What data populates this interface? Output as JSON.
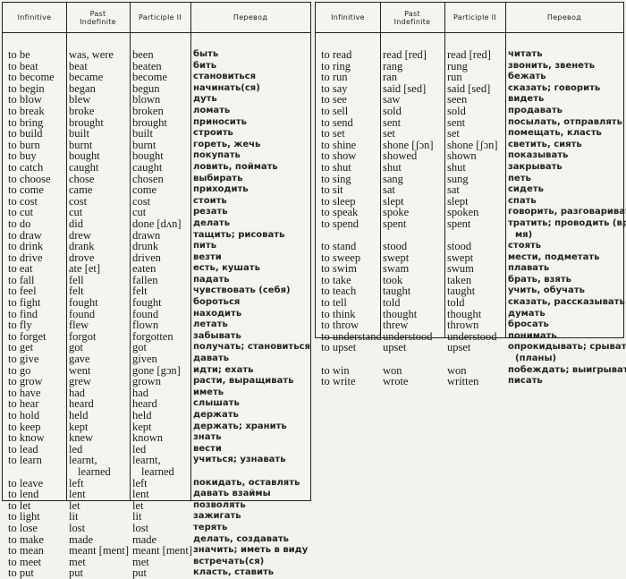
{
  "headers": {
    "infinitive": "Infinitive",
    "past_line1": "Past",
    "past_line2": "Indefinite",
    "participle": "Participle II",
    "translation": "Перевод"
  },
  "left_table": [
    {
      "inf": "to be",
      "past": "was, were",
      "part": "been",
      "ru": "быть"
    },
    {
      "inf": "to beat",
      "past": "beat",
      "part": "beaten",
      "ru": "бить"
    },
    {
      "inf": "to become",
      "past": "became",
      "part": "become",
      "ru": "становиться"
    },
    {
      "inf": "to begin",
      "past": "began",
      "part": "begun",
      "ru": "начинать(ся)"
    },
    {
      "inf": "to blow",
      "past": "blew",
      "part": "blown",
      "ru": "дуть"
    },
    {
      "inf": "to break",
      "past": "broke",
      "part": "broken",
      "ru": "ломать"
    },
    {
      "inf": "to bring",
      "past": "brought",
      "part": "brought",
      "ru": "приносить"
    },
    {
      "inf": "to build",
      "past": "built",
      "part": "built",
      "ru": "строить"
    },
    {
      "inf": "to burn",
      "past": "burnt",
      "part": "burnt",
      "ru": "гореть, жечь"
    },
    {
      "inf": "to buy",
      "past": "bought",
      "part": "bought",
      "ru": "покупать"
    },
    {
      "inf": "to catch",
      "past": "caught",
      "part": "caught",
      "ru": "ловить, поймать"
    },
    {
      "inf": "to choose",
      "past": "chose",
      "part": "chosen",
      "ru": "выбирать"
    },
    {
      "inf": "to come",
      "past": "came",
      "part": "come",
      "ru": "приходить"
    },
    {
      "inf": "to cost",
      "past": "cost",
      "part": "cost",
      "ru": "стоить"
    },
    {
      "inf": "to cut",
      "past": "cut",
      "part": "cut",
      "ru": "резать"
    },
    {
      "inf": "to do",
      "past": "did",
      "part": "done [dʌn]",
      "ru": "делать"
    },
    {
      "inf": "to draw",
      "past": "drew",
      "part": "drawn",
      "ru": "тащить; рисовать"
    },
    {
      "inf": "to drink",
      "past": "drank",
      "part": "drunk",
      "ru": "пить"
    },
    {
      "inf": "to drive",
      "past": "drove",
      "part": "driven",
      "ru": "везти"
    },
    {
      "inf": "to eat",
      "past": "ate [et]",
      "part": "eaten",
      "ru": "есть, кушать"
    },
    {
      "inf": "to fall",
      "past": "fell",
      "part": "fallen",
      "ru": "падать"
    },
    {
      "inf": "to feel",
      "past": "felt",
      "part": "felt",
      "ru": "чувствовать (себя)"
    },
    {
      "inf": "to fight",
      "past": "fought",
      "part": "fought",
      "ru": "бороться"
    },
    {
      "inf": "to find",
      "past": "found",
      "part": "found",
      "ru": "находить"
    },
    {
      "inf": "to fly",
      "past": "flew",
      "part": "flown",
      "ru": "летать"
    },
    {
      "inf": "to forget",
      "past": "forgot",
      "part": "forgotten",
      "ru": "забывать"
    },
    {
      "inf": "to get",
      "past": "got",
      "part": "got",
      "ru": "получать; становиться"
    },
    {
      "inf": "to give",
      "past": "gave",
      "part": "given",
      "ru": "давать"
    },
    {
      "inf": "to go",
      "past": "went",
      "part": "gone [gɔn]",
      "ru": "идти; ехать"
    },
    {
      "inf": "to grow",
      "past": "grew",
      "part": "grown",
      "ru": "расти, выращивать"
    },
    {
      "inf": "to have",
      "past": "had",
      "part": "had",
      "ru": "иметь"
    },
    {
      "inf": "to hear",
      "past": "heard",
      "part": "heard",
      "ru": "слышать"
    },
    {
      "inf": "to hold",
      "past": "held",
      "part": "held",
      "ru": "держать"
    },
    {
      "inf": "to keep",
      "past": "kept",
      "part": "kept",
      "ru": "держать; хранить"
    },
    {
      "inf": "to know",
      "past": "knew",
      "part": "known",
      "ru": "знать"
    },
    {
      "inf": "to lead",
      "past": "led",
      "part": "led",
      "ru": "вести"
    },
    {
      "inf": "to learn",
      "past": "learnt,",
      "past2": "learned",
      "part": "learnt,",
      "part2": "learned",
      "ru": "учиться; узнавать"
    },
    {
      "inf": "to leave",
      "past": "left",
      "part": "left",
      "ru": "покидать, оставлять"
    },
    {
      "inf": "to lend",
      "past": "lent",
      "part": "lent",
      "ru": "давать взаймы"
    },
    {
      "inf": "to let",
      "past": "let",
      "part": "let",
      "ru": "позволять"
    },
    {
      "inf": "to light",
      "past": "lit",
      "part": "lit",
      "ru": "зажигать"
    },
    {
      "inf": "to lose",
      "past": "lost",
      "part": "lost",
      "ru": "терять"
    },
    {
      "inf": "to make",
      "past": "made",
      "part": "made",
      "ru": "делать, создавать"
    },
    {
      "inf": "to mean",
      "past": "meant [ment]",
      "part": "meant [ment]",
      "ru": "значить; иметь в виду"
    },
    {
      "inf": "to meet",
      "past": "met",
      "part": "met",
      "ru": "встречать(ся)"
    },
    {
      "inf": "to put",
      "past": "put",
      "part": "put",
      "ru": "класть, ставить"
    }
  ],
  "right_table": [
    {
      "inf": "to read",
      "past": "read [red]",
      "part": "read [red]",
      "ru": "читать"
    },
    {
      "inf": "to ring",
      "past": "rang",
      "part": "rung",
      "ru": "звонить, звенеть"
    },
    {
      "inf": "to run",
      "past": "ran",
      "part": "run",
      "ru": "бежать"
    },
    {
      "inf": "to say",
      "past": "said [sed]",
      "part": "said [sed]",
      "ru": "сказать; говорить"
    },
    {
      "inf": "to see",
      "past": "saw",
      "part": "seen",
      "ru": "видеть"
    },
    {
      "inf": "to sell",
      "past": "sold",
      "part": "sold",
      "ru": "продавать"
    },
    {
      "inf": "to send",
      "past": "sent",
      "part": "sent",
      "ru": "посылать, отправлять"
    },
    {
      "inf": "to set",
      "past": "set",
      "part": "set",
      "ru": "помещать, класть"
    },
    {
      "inf": "to shine",
      "past": "shone [ʃɔn]",
      "part": "shone [ʃɔn]",
      "ru": "светить, сиять"
    },
    {
      "inf": "to show",
      "past": "showed",
      "part": "shown",
      "ru": "показывать"
    },
    {
      "inf": "to shut",
      "past": "shut",
      "part": "shut",
      "ru": "закрывать"
    },
    {
      "inf": "to sing",
      "past": "sang",
      "part": "sung",
      "ru": "петь"
    },
    {
      "inf": "to sit",
      "past": "sat",
      "part": "sat",
      "ru": "сидеть"
    },
    {
      "inf": "to sleep",
      "past": "slept",
      "part": "slept",
      "ru": "спать"
    },
    {
      "inf": "to speak",
      "past": "spoke",
      "part": "spoken",
      "ru": "говорить, разговаривать"
    },
    {
      "inf": "to spend",
      "past": "spent",
      "part": "spent",
      "ru": "тратить; проводить (вре-",
      "ru2": "мя)"
    },
    {
      "inf": "to stand",
      "past": "stood",
      "part": "stood",
      "ru": "стоять"
    },
    {
      "inf": "to sweep",
      "past": "swept",
      "part": "swept",
      "ru": "мести, подметать"
    },
    {
      "inf": "to swim",
      "past": "swam",
      "part": "swum",
      "ru": "плавать"
    },
    {
      "inf": "to take",
      "past": "took",
      "part": "taken",
      "ru": "брать, взять"
    },
    {
      "inf": "to teach",
      "past": "taught",
      "part": "taught",
      "ru": "учить, обучать"
    },
    {
      "inf": "to tell",
      "past": "told",
      "part": "told",
      "ru": "сказать, рассказывать"
    },
    {
      "inf": "to think",
      "past": "thought",
      "part": "thought",
      "ru": "думать"
    },
    {
      "inf": "to throw",
      "past": "threw",
      "part": "thrown",
      "ru": "бросать"
    },
    {
      "inf": "to understand",
      "past": "understood",
      "part": "understood",
      "ru": "понимать"
    },
    {
      "inf": "to upset",
      "past": "upset",
      "part": "upset",
      "ru": "опрокидывать;   срывать",
      "ru2": "(планы)"
    },
    {
      "inf": "to win",
      "past": "won",
      "part": "won",
      "ru": "побеждать; выигрывать"
    },
    {
      "inf": "to write",
      "past": "wrote",
      "part": "written",
      "ru": "писать"
    }
  ]
}
